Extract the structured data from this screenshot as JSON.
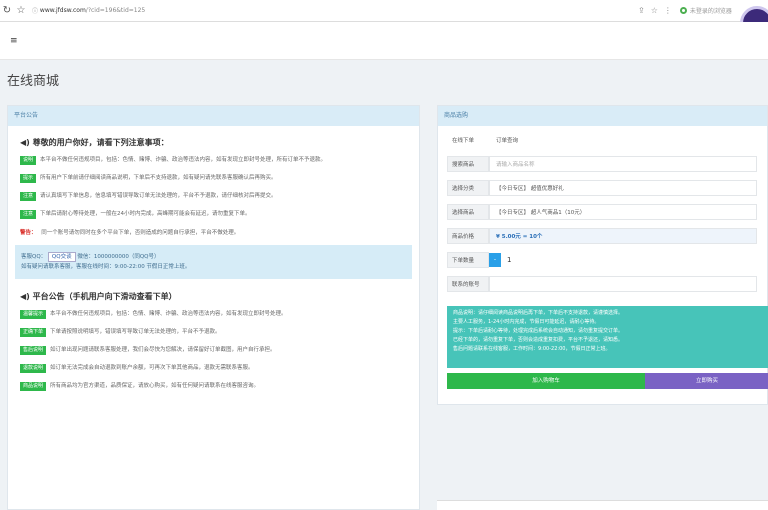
{
  "browser": {
    "url_host": "www.jfdsw.com",
    "url_path": "/?cid=196&tid=125",
    "profile_label": "未登录的浏览器"
  },
  "page": {
    "title": "在线商城"
  },
  "notice_panel": {
    "header": "平台公告",
    "section1_title": "尊敬的用户你好，请看下列注意事项：",
    "items1": [
      {
        "tag": "说明",
        "text": "本平台不做任何违规项目，包括：色情、赌博、诈骗、政治等违法内容，如有发现立即封号处理，所有订单不予退款。"
      },
      {
        "tag": "提示",
        "text": "所有用户下单前请仔细阅读商品说明，下单后不支持退款，如有疑问请先联系客服确认后再购买。"
      },
      {
        "tag": "注意",
        "text": "请认真填写下单信息，信息填写错误导致订单无法处理的，平台不予退款，请仔细核对后再提交。"
      },
      {
        "tag": "注意",
        "text": "下单后请耐心等待处理，一般在24小时内完成，高峰期可能会有延迟，请勿重复下单。"
      }
    ],
    "warning_label": "警告：",
    "warning_text": "同一个账号请勿同时在多个平台下单，否则造成的问题自行承担，平台不做处理。",
    "contact_line1_label": "客服QQ：",
    "contact_qq_badge": "QQ交谈",
    "contact_line1_rest": "微信：1000000000（同QQ号）",
    "contact_line2": "如有疑问请联系客服，客服在线时间：9:00-22:00 节假日正常上班。",
    "section2_title": "平台公告（手机用户向下滑动查看下单）",
    "items2": [
      {
        "tag": "温馨提示",
        "text": "本平台不做任何违规项目，包括：色情、赌博、诈骗、政治等违法内容，如有发现立即封号处理。"
      },
      {
        "tag": "正确下单",
        "text": "下单请按照说明填写，错误填写导致订单无法处理的，平台不予退款。"
      },
      {
        "tag": "售后说明",
        "text": "如订单出现问题请联系客服处理，我们会尽快为您解决，请保留好订单截图，用户自行承担。"
      },
      {
        "tag": "退款说明",
        "text": "如订单无法完成会自动退款到账户余额，可再次下单其他商品，退款无需联系客服。"
      },
      {
        "tag": "商品说明",
        "text": "所有商品均为官方渠道，品质保证，请放心购买，如有任何疑问请联系在线客服咨询。"
      }
    ]
  },
  "order_panel": {
    "header": "商品选购",
    "tab_label": "在线下单",
    "tab_value": "订单查询",
    "search_label": "搜索商品",
    "search_placeholder": "请输入商品名称",
    "category_label": "选择分类",
    "category_value": "【今日专区】 超值优惠好礼",
    "product_label": "选择商品",
    "product_value": "【今日专区】 超人气商品1（10元）",
    "price_label": "商品价格",
    "price_value": "¥ 5.00元 = 10个",
    "qty_label": "下单数量",
    "qty_btn": "-",
    "qty_value": "1",
    "account_label": "联系的账号",
    "notice_lines": [
      "商品说明：请仔细阅读商品说明后再下单，下单后不支持退款，请谨慎选择。",
      "主要人工服务，1-24小时内完成，节假日可能延迟，请耐心等待。",
      "提示：下单后请耐心等待，处理完成后系统会自动通知，请勿重复提交订单。",
      "已经下单的，请勿重复下单，否则会造成重复扣费，平台不予退还，请知悉。",
      "售后问题请联系在线客服，工作时间：9:00-22:00，节假日正常上班。"
    ],
    "add_cart_label": "加入购物车",
    "buy_now_label": "立即购买"
  }
}
